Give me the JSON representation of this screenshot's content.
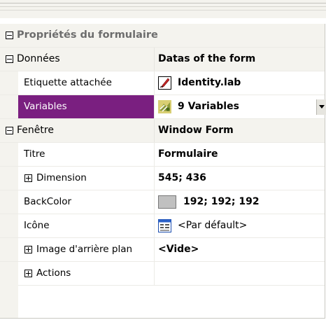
{
  "panel": {
    "header": "Propriétés du formulaire",
    "categories": [
      {
        "label": "Données",
        "description": "Datas of the form"
      },
      {
        "label": "Fenêtre",
        "description": "Window Form"
      }
    ],
    "properties": {
      "etiquette": {
        "name": "Etiquette attachée",
        "value": "Identity.lab",
        "icon": "pen-document-icon"
      },
      "variables": {
        "name": "Variables",
        "value": "9 Variables",
        "icon": "variables-icon",
        "selected": true
      },
      "titre": {
        "name": "Titre",
        "value": "Formulaire"
      },
      "dimension": {
        "name": "Dimension",
        "value": "545; 436"
      },
      "backcolor": {
        "name": "BackColor",
        "value": "192; 192; 192",
        "swatch": "#c0c0c0"
      },
      "icone": {
        "name": "Icône",
        "value": "<Par défault>",
        "icon": "form-window-icon"
      },
      "image": {
        "name": "Image d'arrière plan",
        "value": "<Vide>"
      },
      "actions": {
        "name": "Actions",
        "value": ""
      }
    }
  },
  "colors": {
    "selection": "#7a1f80",
    "gutter": "#f4f3ee",
    "grid_lines": "#ecebe6"
  }
}
